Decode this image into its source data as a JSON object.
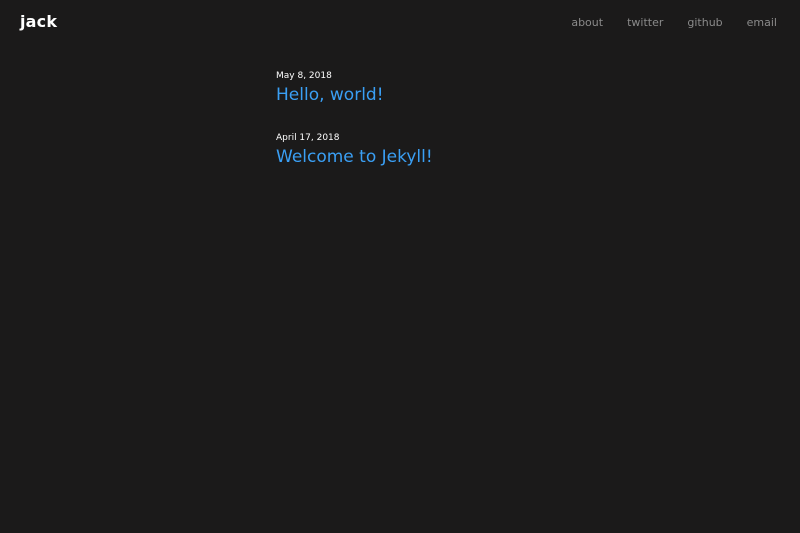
{
  "site": {
    "title": "jack"
  },
  "nav": {
    "items": [
      {
        "label": "about"
      },
      {
        "label": "twitter"
      },
      {
        "label": "github"
      },
      {
        "label": "email"
      }
    ]
  },
  "posts": [
    {
      "date": "May 8, 2018",
      "title": "Hello, world!"
    },
    {
      "date": "April 17, 2018",
      "title": "Welcome to Jekyll!"
    }
  ],
  "colors": {
    "background": "#1b1a1a",
    "title": "#ffffff",
    "nav_link": "#8a8a8a",
    "post_link": "#3a9ff4"
  }
}
